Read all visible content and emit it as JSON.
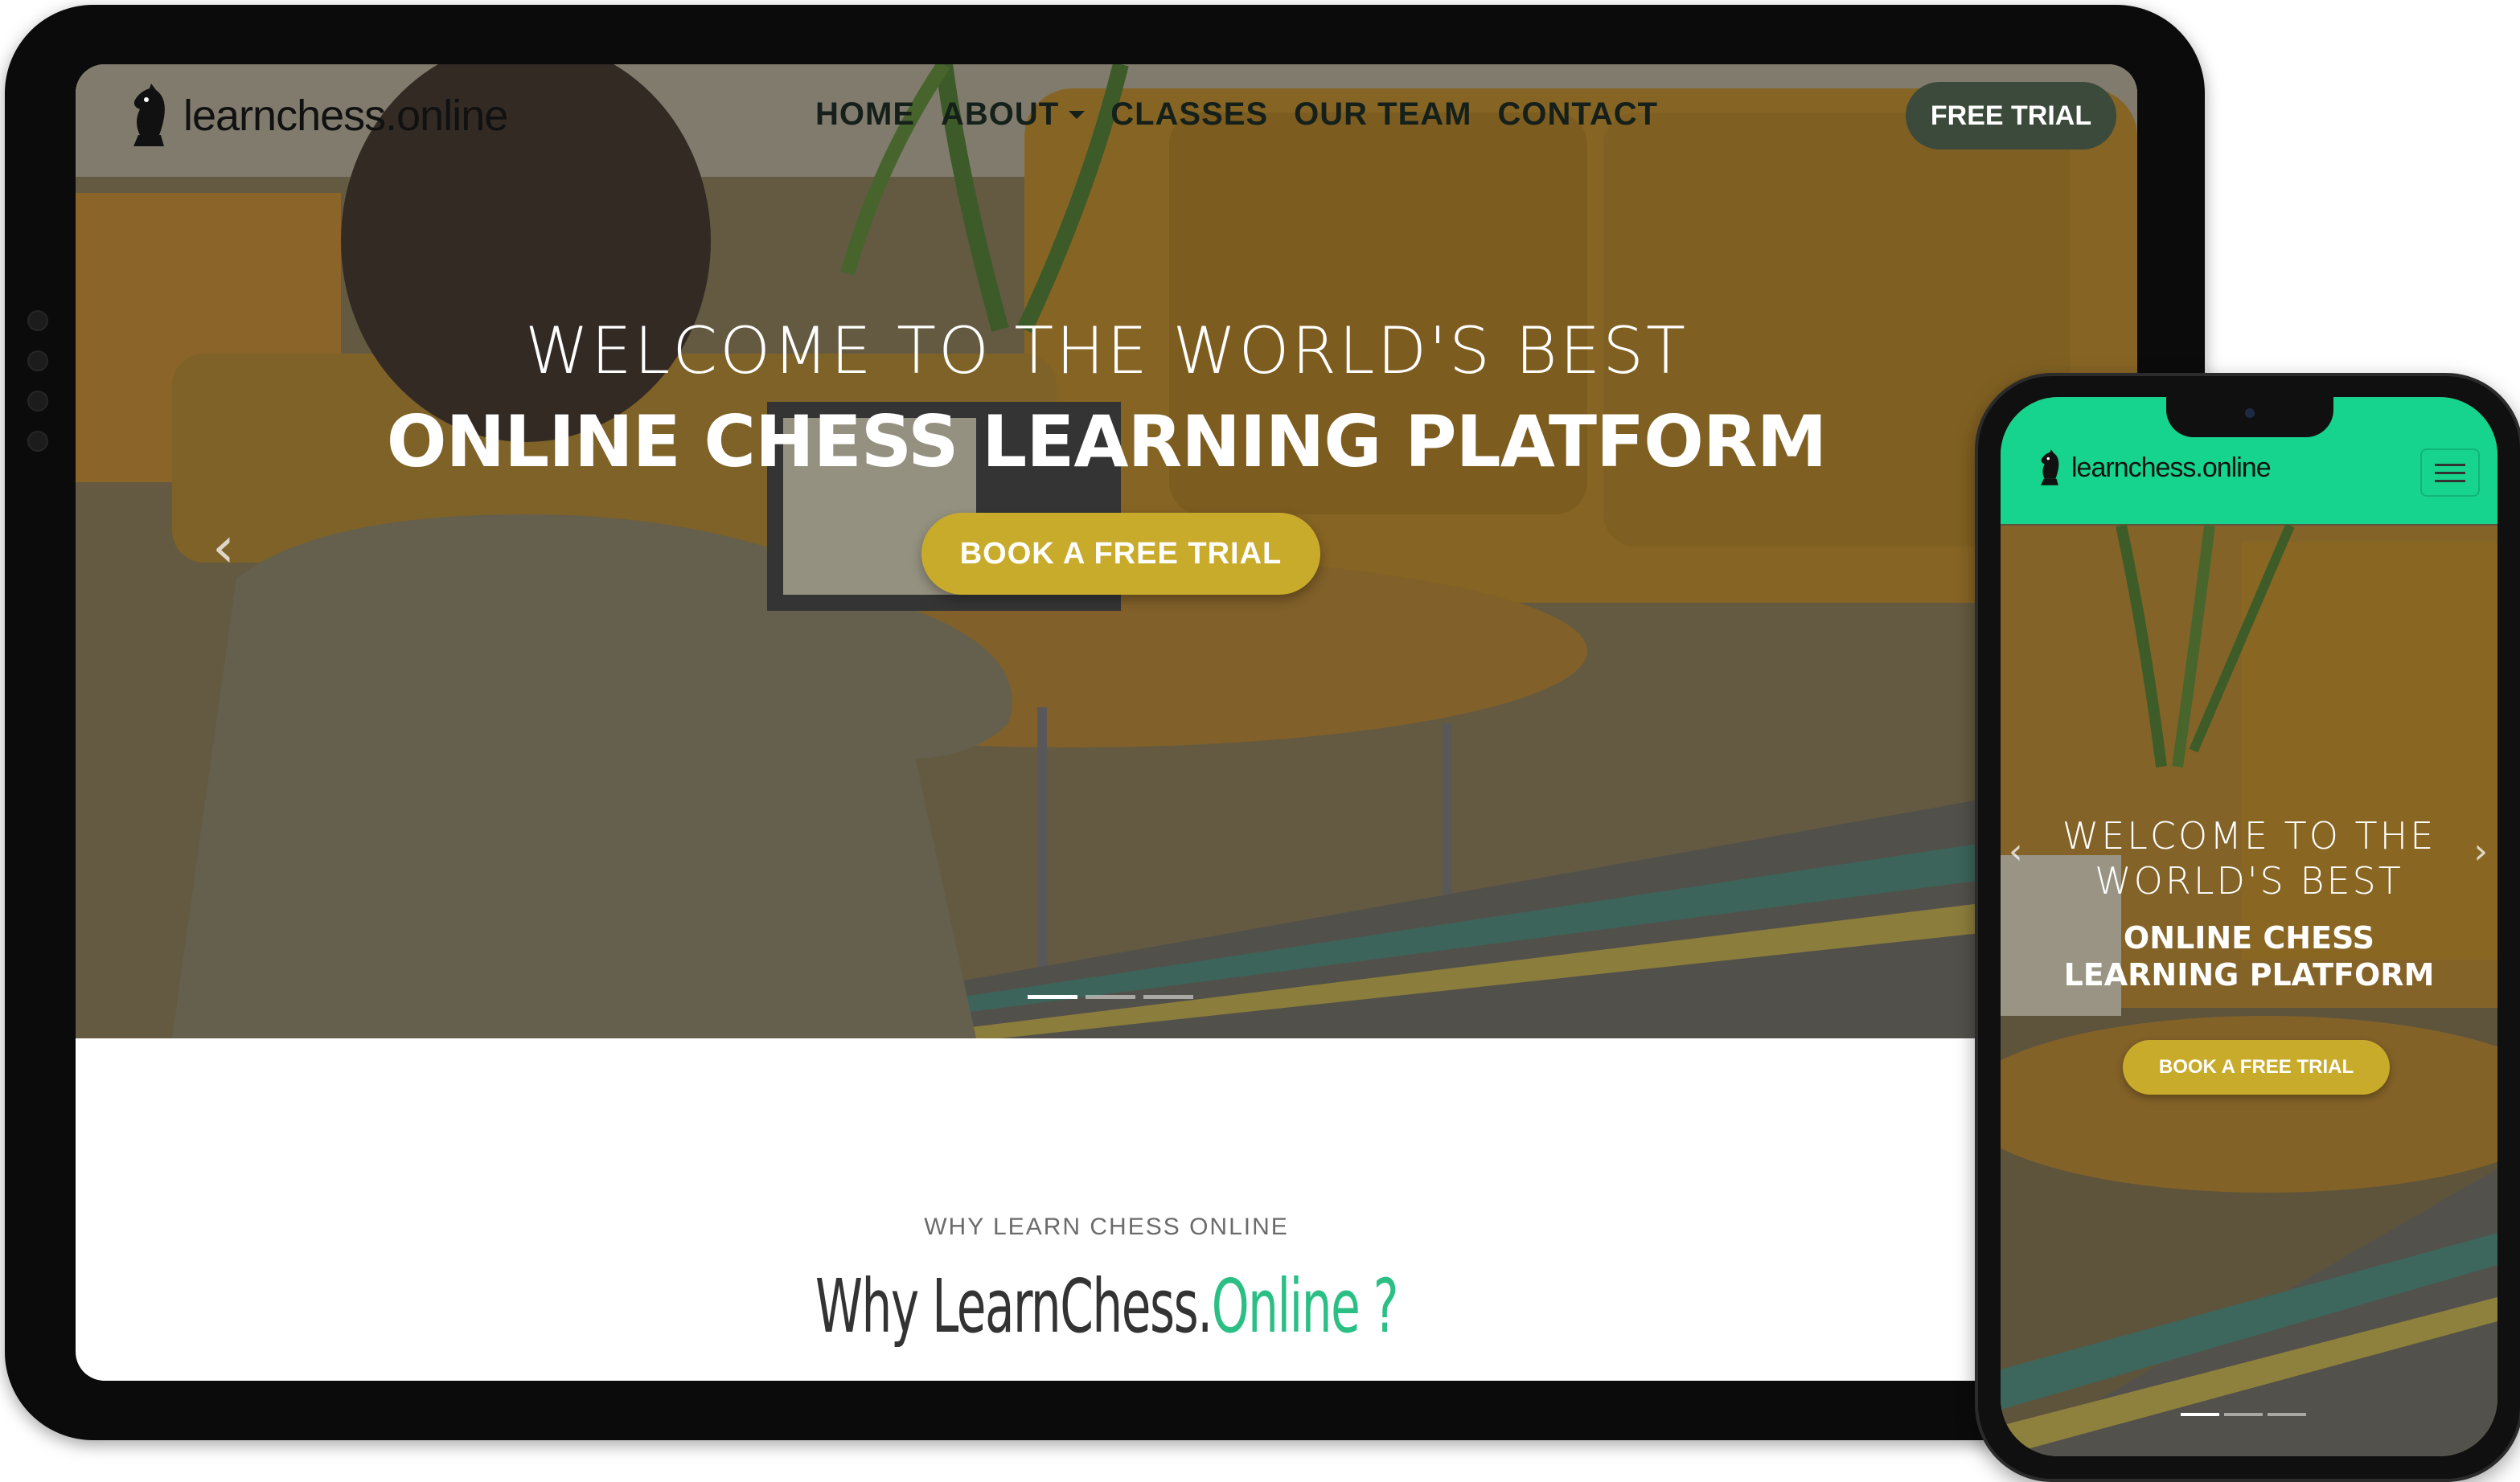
{
  "tablet": {
    "logo_text": "learnchess.online",
    "nav": {
      "items": [
        {
          "label": "HOME"
        },
        {
          "label": "ABOUT"
        },
        {
          "label": "CLASSES"
        },
        {
          "label": "OUR TEAM"
        },
        {
          "label": "CONTACT"
        }
      ],
      "cta": "FREE TRIAL"
    },
    "hero": {
      "title_line1": "WELCOME TO THE WORLD'S BEST",
      "title_line2": "ONLINE CHESS LEARNING PLATFORM",
      "cta": "BOOK A FREE TRIAL",
      "slide_count": 3,
      "active_slide": 1
    },
    "section": {
      "subtitle": "WHY LEARN CHESS ONLINE",
      "title_main": "Why LearnChess.",
      "title_accent": "Online ?"
    }
  },
  "phone": {
    "logo_text": "learnchess.online",
    "hero": {
      "title_line1": "WELCOME TO THE",
      "title_line2": "WORLD'S BEST",
      "subtitle_line1": "ONLINE CHESS",
      "subtitle_line2": "LEARNING PLATFORM",
      "cta": "BOOK A FREE TRIAL",
      "slide_count": 3,
      "active_slide": 1
    }
  },
  "colors": {
    "brand_green": "#16d48d",
    "cta_gold": "#c9ab2c",
    "nav_pill": "#3b4a3a",
    "accent_text": "#2bbf86"
  }
}
